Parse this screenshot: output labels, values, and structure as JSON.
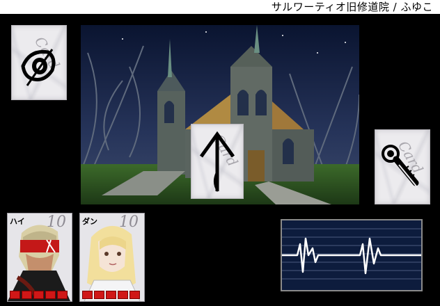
{
  "header": {
    "title": "サルワーティオ旧修道院 / ふゆこ"
  },
  "cards": {
    "eye": {
      "icon": "eye-icon",
      "watermark": "Card"
    },
    "arrow": {
      "icon": "up-arrow-icon",
      "watermark": "Card"
    },
    "hand": {
      "icon": "magnifier-hand-icon",
      "watermark": "Card"
    }
  },
  "scene": {
    "description_icon": "gothic-abbey-night-scene"
  },
  "party": [
    {
      "name": "ハイ",
      "level": "10",
      "hp_pips": 5,
      "hp_color": "#d01717"
    },
    {
      "name": "ダン",
      "level": "10",
      "hp_pips": 5,
      "hp_color": "#d01717"
    }
  ],
  "monitor": {
    "icon": "heartbeat-monitor-icon",
    "line_color": "#ffffff"
  }
}
